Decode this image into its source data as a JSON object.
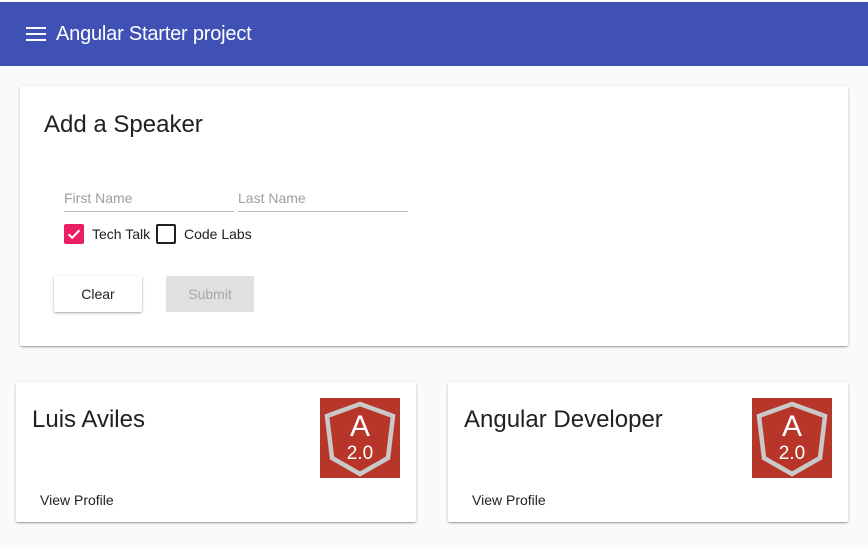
{
  "toolbar": {
    "menu_icon": "menu-icon",
    "title": "Angular Starter project",
    "color": "#3f51b5"
  },
  "form": {
    "title": "Add a Speaker",
    "first_name": {
      "placeholder": "First Name",
      "value": ""
    },
    "last_name": {
      "placeholder": "Last Name",
      "value": ""
    },
    "checkboxes": [
      {
        "label": "Tech Talk",
        "checked": true
      },
      {
        "label": "Code Labs",
        "checked": false
      }
    ],
    "clear_label": "Clear",
    "submit_label": "Submit",
    "submit_disabled": true,
    "accent": "#e91e63"
  },
  "speakers": [
    {
      "name": "Luis Aviles",
      "avatar": {
        "icon": "angular-2-logo-icon",
        "text": "A",
        "version": "2.0"
      },
      "action": "View Profile"
    },
    {
      "name": "Angular Developer",
      "avatar": {
        "icon": "angular-2-logo-icon",
        "text": "A",
        "version": "2.0"
      },
      "action": "View Profile"
    }
  ]
}
